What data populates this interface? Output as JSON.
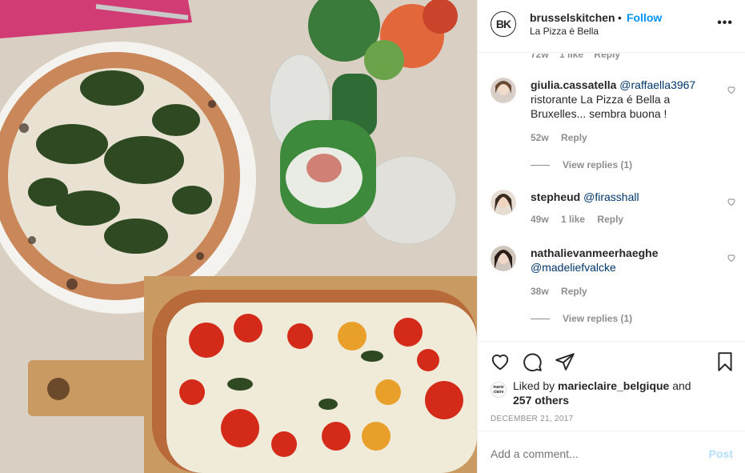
{
  "post": {
    "account": {
      "username": "brusselskitchen",
      "avatar_text": "BK",
      "location": "La Pizza è Bella",
      "follow_label": "Follow",
      "separator": "•"
    },
    "comments": [
      {
        "username": "giulia.cassatella",
        "mention": "@raffaella3967",
        "text": "ristorante La Pizza é Bella a Bruxelles... sembra buona !",
        "time": "52w",
        "likes": "",
        "reply_label": "Reply",
        "view_replies": "View replies (1)"
      },
      {
        "username": "stepheud",
        "mention": "@firasshall",
        "text": "",
        "time": "49w",
        "likes": "1 like",
        "reply_label": "Reply",
        "view_replies": ""
      },
      {
        "username": "nathalievanmeerhaeghe",
        "mention": "@madeliefvalcke",
        "text": "",
        "time": "38w",
        "likes": "",
        "reply_label": "Reply",
        "view_replies": "View replies (1)"
      }
    ],
    "cut_comment_meta": {
      "time": "72w",
      "likes": "1 like",
      "reply_label": "Reply"
    },
    "likes": {
      "prefix": "Liked by",
      "user": "marieclaire_belgique",
      "joiner": "and",
      "others": "257 others",
      "avatar_text": "marie claire"
    },
    "date": "DECEMBER 21, 2017",
    "add_comment": {
      "placeholder": "Add a comment...",
      "post_label": "Post"
    },
    "icons": {
      "like": "heart-outline-icon",
      "comment": "speech-bubble-icon",
      "share": "paper-plane-icon",
      "save": "bookmark-icon",
      "more": "ellipsis-icon",
      "comment_like": "small-heart-icon"
    },
    "colors": {
      "link": "#0095f6",
      "mention": "#00376b",
      "muted": "#8e8e8e",
      "post_disabled": "#b2dffc"
    }
  }
}
